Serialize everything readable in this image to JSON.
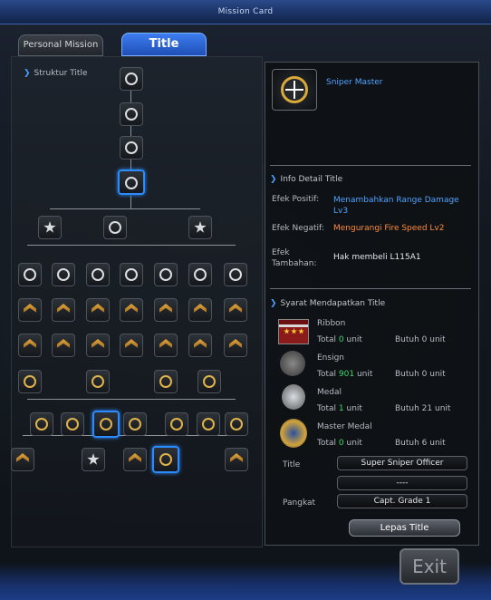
{
  "window": {
    "title": "Mission Card"
  },
  "tabs": [
    {
      "label": "Personal Mission",
      "active": false
    },
    {
      "label": "Title",
      "active": true
    }
  ],
  "tree": {
    "heading": "Struktur Title"
  },
  "detail": {
    "title_name": "Sniper Master",
    "info_heading": "Info Detail Title",
    "efek_positif_label": "Efek Positif:",
    "efek_positif_value": "Menambahkan Range Damage Lv3",
    "efek_negatif_label": "Efek Negatif:",
    "efek_negatif_value": "Mengurangi Fire Speed Lv2",
    "efek_tambahan_label": "Efek Tambahan:",
    "efek_tambahan_value": "Hak membeli L115A1",
    "syarat_heading": "Syarat Mendapatkan Title",
    "requirements": [
      {
        "name": "Ribbon",
        "total_label": "Total",
        "total": "0",
        "unit": "unit",
        "butuh": "Butuh 0 unit"
      },
      {
        "name": "Ensign",
        "total_label": "Total",
        "total": "901",
        "unit": "unit",
        "butuh": "Butuh 0 unit"
      },
      {
        "name": "Medal",
        "total_label": "Total",
        "total": "1",
        "unit": "unit",
        "butuh": "Butuh 21 unit"
      },
      {
        "name": "Master Medal",
        "total_label": "Total",
        "total": "0",
        "unit": "unit",
        "butuh": "Butuh 6 unit"
      }
    ],
    "title_label": "Title",
    "title_value": "Super Sniper Officer",
    "title_value2": "----",
    "pangkat_label": "Pangkat",
    "pangkat_value": "Capt. Grade 1",
    "lepas_button": "Lepas Title"
  },
  "exit_button": "Exit",
  "colors": {
    "accent": "#2c8cff",
    "positive": "#4fa3ff",
    "negative": "#ff8a3a",
    "count": "#3cd86a"
  }
}
